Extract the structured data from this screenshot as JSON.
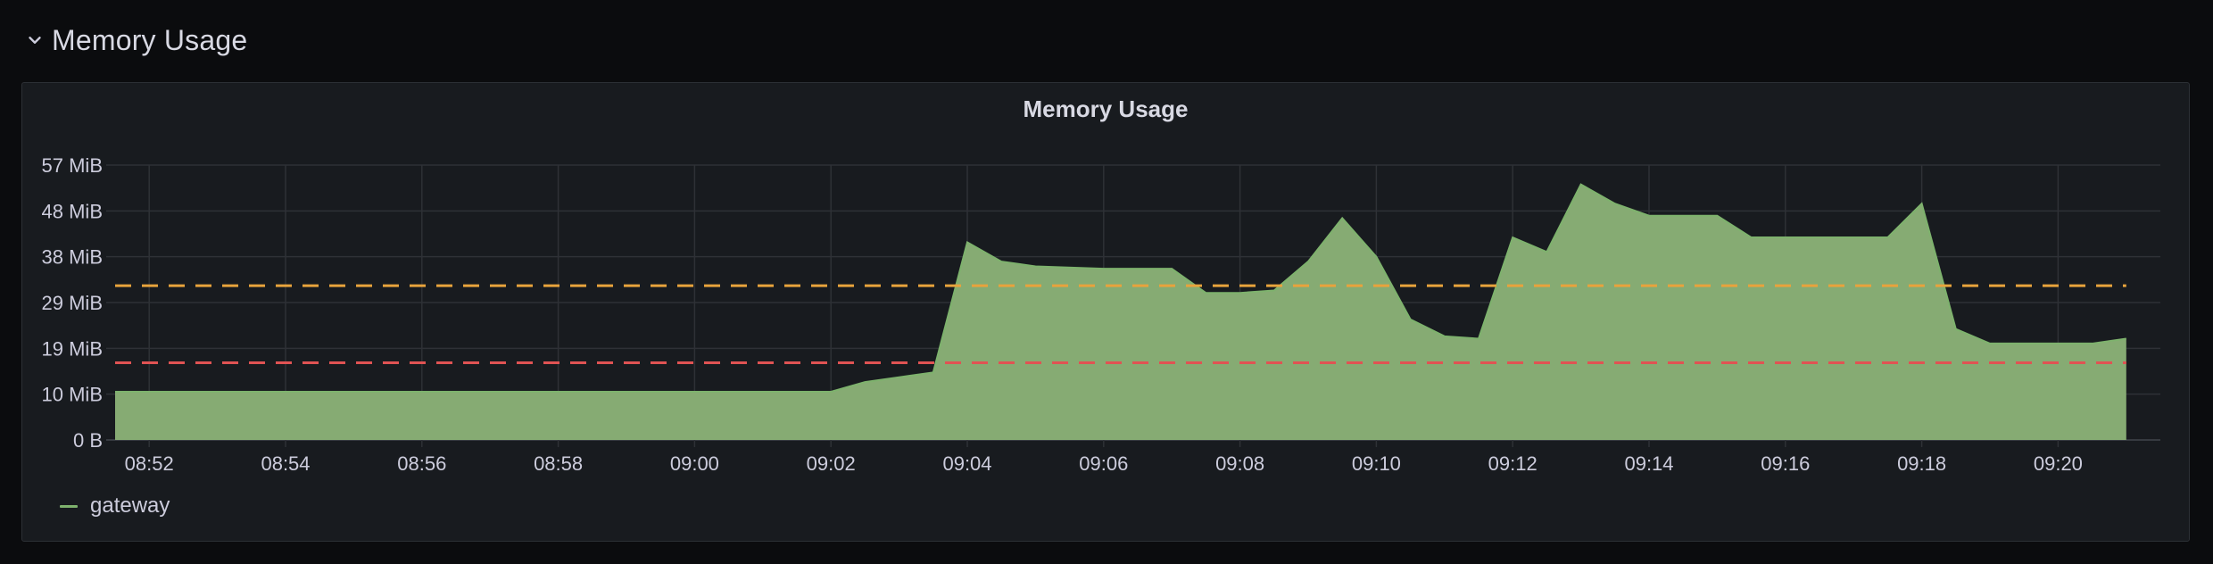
{
  "row": {
    "title": "Memory Usage"
  },
  "panel": {
    "title": "Memory Usage"
  },
  "colors": {
    "series": "#7eb26d",
    "fill": "#86ab73",
    "threshold_warn": "#e8a33c",
    "threshold_crit": "#e05353",
    "grid": "#2e3136",
    "text": "#ccccdc"
  },
  "chart_data": {
    "type": "area",
    "y_ticks": [
      "0 B",
      "10 MiB",
      "19 MiB",
      "29 MiB",
      "38 MiB",
      "48 MiB",
      "57 MiB"
    ],
    "y_tick_values": [
      0,
      9.5,
      19,
      28.5,
      38,
      47.5,
      57
    ],
    "ylim": [
      0,
      57
    ],
    "y_unit": "MiB",
    "x_ticks": [
      "08:52",
      "08:54",
      "08:56",
      "08:58",
      "09:00",
      "09:02",
      "09:04",
      "09:06",
      "09:08",
      "09:10",
      "09:12",
      "09:14",
      "09:16",
      "09:18",
      "09:20"
    ],
    "xlim": [
      "08:51:30",
      "09:21:30"
    ],
    "grid": true,
    "legend_position": "bottom-left",
    "thresholds": [
      {
        "value": 16,
        "color": "red",
        "style": "dashed"
      },
      {
        "value": 32,
        "color": "orange",
        "style": "dashed"
      }
    ],
    "series": [
      {
        "name": "gateway",
        "x": [
          "08:51:30",
          "09:02:00",
          "09:02:30",
          "09:03:00",
          "09:03:30",
          "09:04:00",
          "09:04:30",
          "09:05:00",
          "09:06:00",
          "09:07:00",
          "09:07:30",
          "09:08:00",
          "09:08:30",
          "09:09:00",
          "09:09:30",
          "09:10:00",
          "09:10:30",
          "09:11:00",
          "09:11:30",
          "09:12:00",
          "09:12:30",
          "09:13:00",
          "09:13:30",
          "09:14:00",
          "09:14:30",
          "09:15:00",
          "09:15:30",
          "09:16:00",
          "09:16:30",
          "09:17:00",
          "09:17:30",
          "09:18:00",
          "09:18:30",
          "09:19:00",
          "09:19:30",
          "09:20:00",
          "09:20:30",
          "09:21:00"
        ],
        "values": [
          10,
          10,
          12,
          13,
          14,
          41,
          37,
          36,
          35.5,
          35.5,
          30.5,
          30.5,
          31,
          37,
          46,
          38,
          25,
          21.5,
          21,
          42,
          39,
          53,
          49,
          46.5,
          46.5,
          46.5,
          42,
          42,
          42,
          42,
          42,
          49,
          23,
          20,
          20,
          20,
          20,
          21
        ]
      }
    ]
  },
  "legend": {
    "items": [
      {
        "label": "gateway"
      }
    ]
  }
}
